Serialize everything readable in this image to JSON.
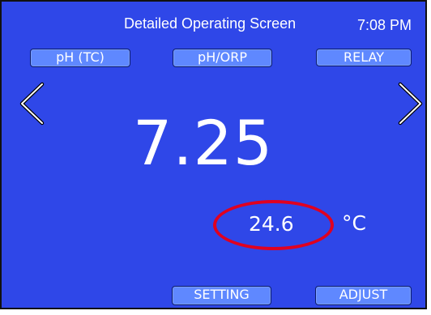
{
  "header": {
    "title": "Detailed Operating Screen",
    "time": "7:08 PM"
  },
  "tabs": [
    {
      "label": "pH (TC)"
    },
    {
      "label": "pH/ORP"
    },
    {
      "label": "RELAY"
    }
  ],
  "navigation": {
    "left_icon": "chevron-left-icon",
    "right_icon": "chevron-right-icon"
  },
  "measurement": {
    "main_value": "7.25",
    "temperature_value": "24.6",
    "temperature_unit": "°C"
  },
  "actions": {
    "setting_label": "SETTING",
    "adjust_label": "ADJUST"
  },
  "colors": {
    "screen_background": "#2f47e8",
    "button_background": "#5f88ff",
    "text": "#ffffff",
    "highlight": "#e00020",
    "border": "#111111"
  }
}
